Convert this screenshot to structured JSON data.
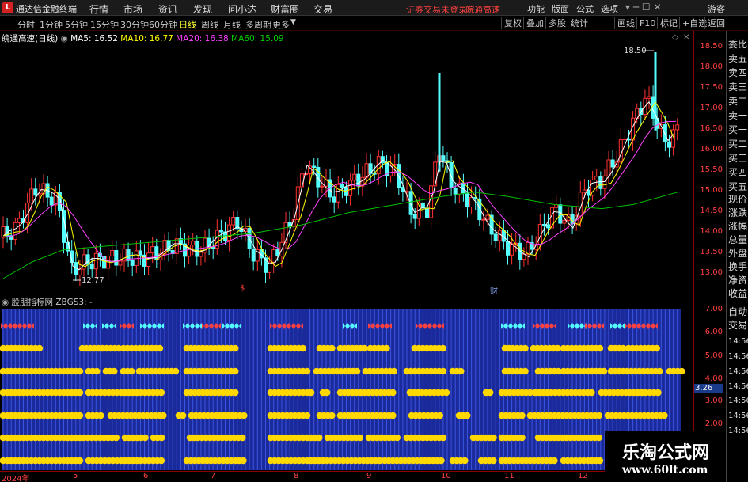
{
  "app": {
    "title": "通达信金融终端",
    "logo": "L"
  },
  "menus": [
    "行情",
    "市场",
    "资讯",
    "发现",
    "问小达",
    "财富圈",
    "交易"
  ],
  "status": {
    "login": "证券交易未登录",
    "stock": "皖通高速"
  },
  "top_right": [
    "功能",
    "版面",
    "公式",
    "选项",
    "游客"
  ],
  "periods": [
    {
      "label": "分时",
      "active": false
    },
    {
      "label": "1分钟",
      "active": false
    },
    {
      "label": "5分钟",
      "active": false
    },
    {
      "label": "15分钟",
      "active": false
    },
    {
      "label": "30分钟",
      "active": false
    },
    {
      "label": "60分钟",
      "active": false
    },
    {
      "label": "日线",
      "active": true
    },
    {
      "label": "周线",
      "active": false
    },
    {
      "label": "月线",
      "active": false
    },
    {
      "label": "多周期",
      "active": false
    },
    {
      "label": "更多",
      "active": false
    }
  ],
  "toolbar_right": [
    "复权",
    "叠加",
    "多股",
    "统计",
    "画线",
    "F10",
    "标记",
    "+自选",
    "返回"
  ],
  "main_info": {
    "stock": "皖通高速(日线)",
    "ma5": "MA5: 16.52",
    "ma10": "MA10: 16.77",
    "ma20": "MA20: 16.38",
    "ma60": "MA60: 15.09"
  },
  "price_ticks": [
    "18.50",
    "18.00",
    "17.50",
    "17.00",
    "16.50",
    "16.00",
    "15.50",
    "15.00",
    "14.50",
    "14.00",
    "13.50",
    "13.00"
  ],
  "high_label": "18.50",
  "low_label": "12.77",
  "event_markers": [
    "$",
    "财"
  ],
  "right_panel": [
    "委比",
    "卖五",
    "卖四",
    "卖三",
    "卖二",
    "卖一",
    "买一",
    "买二",
    "买三",
    "买四",
    "买五",
    "现价",
    "涨跌",
    "涨幅",
    "总量",
    "外盘",
    "换手",
    "净资",
    "收益",
    "自动",
    "交易",
    "14:56",
    "14:56",
    "14:56",
    "14:56",
    "14:56",
    "14:56",
    "14:56"
  ],
  "indicator_info": {
    "name": "股朋指标网",
    "formula": "ZBGS3: -"
  },
  "indicator_ticks": [
    "7.00",
    "6.00",
    "5.00",
    "4.00",
    "3.00",
    "2.00"
  ],
  "indicator_current": "3.26",
  "date_labels": [
    "2024年",
    "5",
    "6",
    "7",
    "8",
    "9",
    "10",
    "11",
    "12"
  ],
  "watermark": {
    "title": "乐淘公式网",
    "url": "www.60lt.com"
  },
  "colors": {
    "up": "#ff3030",
    "down": "#54ffff",
    "ma5": "#ffffff",
    "ma10": "#ffff00",
    "ma20": "#ff40ff",
    "ma60": "#00c000",
    "dot": "#ffd800"
  }
}
